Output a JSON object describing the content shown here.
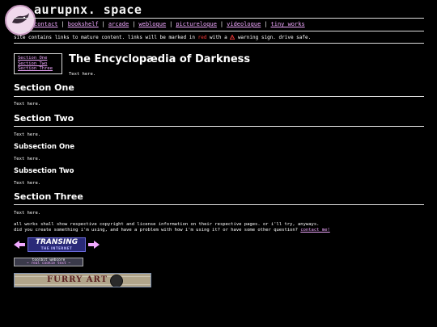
{
  "header": {
    "site_title": "aurupnx. space",
    "nav": [
      "contact",
      "bookshelf",
      "arcade",
      "weblogue",
      "picturelogue",
      "videologue",
      "tiny works"
    ],
    "separator": "|"
  },
  "notice": {
    "before": "site contains links to mature content. links will be marked in ",
    "red_word": "red",
    "middle": " with a ",
    "icon": "warning-icon",
    "after": " warning sign. drive safe."
  },
  "toc": {
    "items": [
      "Section One",
      "Section Two",
      "Section Three"
    ]
  },
  "main": {
    "title": "The Encyclopædia of Darkness",
    "intro": "Text here.",
    "section_one": {
      "title": "Section One",
      "text": "Text here."
    },
    "section_two": {
      "title": "Section Two",
      "text": "Text here."
    },
    "subsection_one": {
      "title": "Subsection One",
      "text": "Text here."
    },
    "subsection_two": {
      "title": "Subsection Two",
      "text": "Text here."
    },
    "section_three": {
      "title": "Section Three",
      "text": "Text here."
    }
  },
  "footer": {
    "line1": "all works shall show respective copyright and license information on their respective pages. or i'll try, anyways.",
    "line2": "did you create something i'm using, and have a problem with how i'm using it? or have some other question?",
    "contact_link": "contact me!"
  },
  "webring": {
    "banner_line1": "TRANSING",
    "banner_line2": "THE INTERNET"
  },
  "badge": {
    "line1": "toolbit webcore",
    "line2": "~ real cookie text ~"
  },
  "furry_banner": {
    "text": "FURRY ART"
  },
  "colors": {
    "background": "#000000",
    "link": "#f0a8ff",
    "warning": "#ff3b3b"
  }
}
